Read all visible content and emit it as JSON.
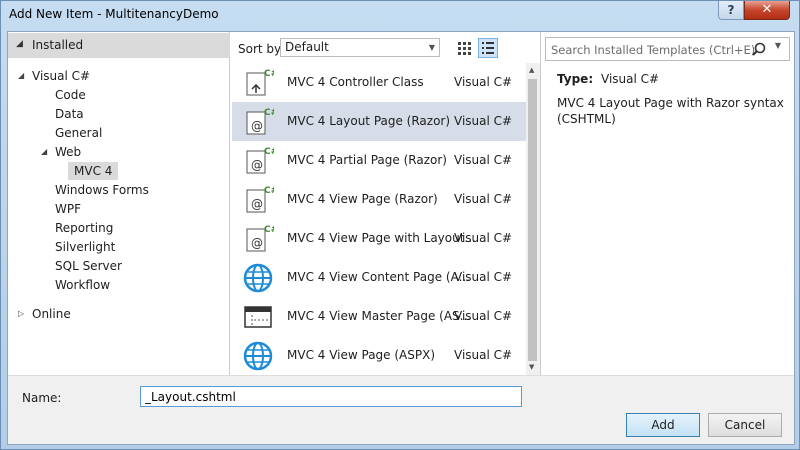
{
  "window": {
    "title": "Add New Item - MultitenancyDemo",
    "help_label": "?",
    "close_label": "✕"
  },
  "left": {
    "installed_label": "Installed",
    "tree": [
      {
        "label": "Visual C#",
        "expanded": true,
        "level": 1
      },
      {
        "label": "Code",
        "level": 2
      },
      {
        "label": "Data",
        "level": 2
      },
      {
        "label": "General",
        "level": 2
      },
      {
        "label": "Web",
        "expanded": true,
        "level": 2
      },
      {
        "label": "MVC 4",
        "level": 3,
        "selected": true
      },
      {
        "label": "Windows Forms",
        "level": 2
      },
      {
        "label": "WPF",
        "level": 2
      },
      {
        "label": "Reporting",
        "level": 2
      },
      {
        "label": "Silverlight",
        "level": 2
      },
      {
        "label": "SQL Server",
        "level": 2
      },
      {
        "label": "Workflow",
        "level": 2
      }
    ],
    "online_label": "Online"
  },
  "toolbar": {
    "sort_label": "Sort by:",
    "sort_value": "Default"
  },
  "templates": [
    {
      "name": "MVC 4 Controller Class",
      "lang": "Visual C#",
      "icon": "controller-icon"
    },
    {
      "name": "MVC 4 Layout Page (Razor)",
      "lang": "Visual C#",
      "icon": "razor-page-icon",
      "selected": true
    },
    {
      "name": "MVC 4 Partial Page (Razor)",
      "lang": "Visual C#",
      "icon": "razor-page-icon"
    },
    {
      "name": "MVC 4 View Page (Razor)",
      "lang": "Visual C#",
      "icon": "razor-page-icon"
    },
    {
      "name": "MVC 4 View Page with Layout...",
      "lang": "Visual C#",
      "icon": "razor-page-icon"
    },
    {
      "name": "MVC 4 View Content Page (A...",
      "lang": "Visual C#",
      "icon": "globe-icon"
    },
    {
      "name": "MVC 4 View Master Page (AS...",
      "lang": "Visual C#",
      "icon": "master-page-icon"
    },
    {
      "name": "MVC 4 View Page (ASPX)",
      "lang": "Visual C#",
      "icon": "globe-icon"
    }
  ],
  "details": {
    "search_placeholder": "Search Installed Templates (Ctrl+E)",
    "type_label": "Type:",
    "type_value": "Visual C#",
    "description": "MVC 4 Layout Page with Razor syntax (CSHTML)"
  },
  "bottom": {
    "name_label": "Name:",
    "name_value": "_Layout.cshtml",
    "add_label": "Add",
    "cancel_label": "Cancel"
  },
  "colors": {
    "selected_row": "#d6dde9",
    "tree_selected": "#dadada",
    "globe_blue": "#1f8bd6",
    "csharp_green": "#3c8a2e"
  }
}
